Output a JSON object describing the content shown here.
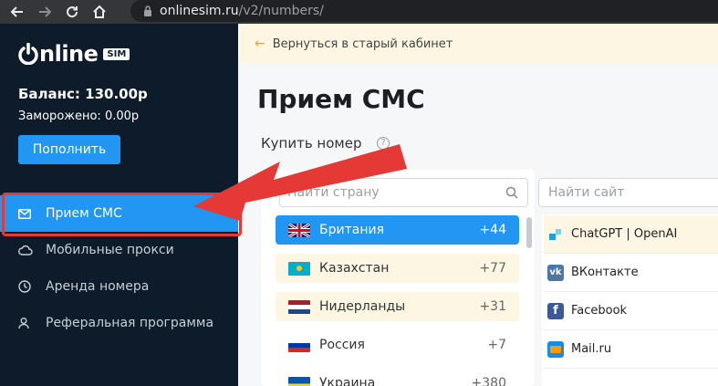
{
  "browser": {
    "url_host": "onlinesim.ru",
    "url_path": "/v2/numbers/"
  },
  "sidebar": {
    "logo_text": "nline",
    "logo_badge": "SIM",
    "balance": "Баланс: 130.00р",
    "frozen": "Заморожено: 0.00р",
    "topup_label": "Пополнить",
    "items": [
      {
        "label": "Прием СМС",
        "icon": "mail-icon",
        "active": true
      },
      {
        "label": "Мобильные прокси",
        "icon": "cloud-icon",
        "active": false
      },
      {
        "label": "Аренда номера",
        "icon": "clock-icon",
        "active": false
      },
      {
        "label": "Реферальная программа",
        "icon": "users-icon",
        "active": false
      }
    ]
  },
  "notice": {
    "text": "Вернуться в старый кабинет"
  },
  "main": {
    "title": "Прием СМС",
    "buy_label": "Купить номер",
    "help": "?",
    "country_search_placeholder": "Найти страну",
    "site_search_placeholder": "Найти сайт",
    "countries": [
      {
        "name": "Британия",
        "code": "+44",
        "state": "active"
      },
      {
        "name": "Казахстан",
        "code": "+77",
        "state": "fav"
      },
      {
        "name": "Нидерланды",
        "code": "+31",
        "state": "fav"
      },
      {
        "name": "Россия",
        "code": "+7",
        "state": "normal"
      },
      {
        "name": "Украина",
        "code": "+380",
        "state": "normal"
      }
    ],
    "sites": [
      {
        "name": "ChatGPT | OpenAI",
        "icon": "chatgpt-icon",
        "state": "fav"
      },
      {
        "name": "ВКонтакте",
        "icon": "vk-icon",
        "state": "normal"
      },
      {
        "name": "Facebook",
        "icon": "facebook-icon",
        "state": "normal"
      },
      {
        "name": "Mail.ru",
        "icon": "mailru-icon",
        "state": "normal"
      }
    ]
  },
  "colors": {
    "sidebar_bg": "#0d1b2a",
    "accent": "#2196f3",
    "annotation": "#e53935"
  }
}
